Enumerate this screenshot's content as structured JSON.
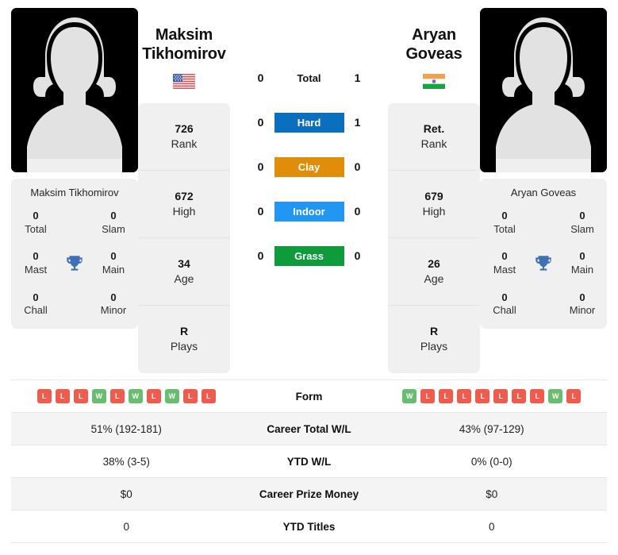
{
  "players": {
    "left": {
      "name_line1": "Maksim",
      "name_line2": "Tikhomirov",
      "full_name": "Maksim Tikhomirov",
      "flag_name": "usa-flag",
      "country": "USA",
      "avatar_name": "player-photo-placeholder",
      "stats": [
        {
          "value": "726",
          "label": "Rank"
        },
        {
          "value": "672",
          "label": "High"
        },
        {
          "value": "34",
          "label": "Age"
        },
        {
          "value": "R",
          "label": "Plays"
        }
      ],
      "titles": [
        {
          "value": "0",
          "label": "Total"
        },
        {
          "value": "0",
          "label": "Slam"
        },
        {
          "value": "0",
          "label": "Mast"
        },
        {
          "value": "0",
          "label": "Main"
        },
        {
          "value": "0",
          "label": "Chall"
        },
        {
          "value": "0",
          "label": "Minor"
        }
      ],
      "form": [
        "L",
        "L",
        "L",
        "W",
        "L",
        "W",
        "L",
        "W",
        "L",
        "L"
      ],
      "career_total_wl": "51% (192-181)",
      "ytd_wl": "38% (3-5)",
      "career_prize_money": "$0",
      "ytd_titles": "0"
    },
    "right": {
      "name_line1": "Aryan",
      "name_line2": "Goveas",
      "full_name": "Aryan Goveas",
      "flag_name": "india-flag",
      "country": "India",
      "avatar_name": "player-photo-placeholder",
      "stats": [
        {
          "value": "Ret.",
          "label": "Rank"
        },
        {
          "value": "679",
          "label": "High"
        },
        {
          "value": "26",
          "label": "Age"
        },
        {
          "value": "R",
          "label": "Plays"
        }
      ],
      "titles": [
        {
          "value": "0",
          "label": "Total"
        },
        {
          "value": "0",
          "label": "Slam"
        },
        {
          "value": "0",
          "label": "Mast"
        },
        {
          "value": "0",
          "label": "Main"
        },
        {
          "value": "0",
          "label": "Chall"
        },
        {
          "value": "0",
          "label": "Minor"
        }
      ],
      "form": [
        "W",
        "L",
        "L",
        "L",
        "L",
        "L",
        "L",
        "L",
        "W",
        "L"
      ],
      "career_total_wl": "43% (97-129)",
      "ytd_wl": "0% (0-0)",
      "career_prize_money": "$0",
      "ytd_titles": "0"
    }
  },
  "head_to_head": {
    "rows": [
      {
        "label": "Total",
        "left": "0",
        "right": "1",
        "color": null,
        "bar": false
      },
      {
        "label": "Hard",
        "left": "0",
        "right": "1",
        "color": "#0b6fc0",
        "bar": true
      },
      {
        "label": "Clay",
        "left": "0",
        "right": "0",
        "color": "#e08d0a",
        "bar": true
      },
      {
        "label": "Indoor",
        "left": "0",
        "right": "0",
        "color": "#2196f3",
        "bar": true
      },
      {
        "label": "Grass",
        "left": "0",
        "right": "0",
        "color": "#0d9b3c",
        "bar": true
      }
    ]
  },
  "table": {
    "rows": [
      {
        "key": "form",
        "label": "Form",
        "type": "form"
      },
      {
        "key": "career_total_wl",
        "label": "Career Total W/L",
        "type": "text"
      },
      {
        "key": "ytd_wl",
        "label": "YTD W/L",
        "type": "text"
      },
      {
        "key": "career_prize_money",
        "label": "Career Prize Money",
        "type": "text"
      },
      {
        "key": "ytd_titles",
        "label": "YTD Titles",
        "type": "text"
      }
    ]
  },
  "colors": {
    "win_badge": "#68bd6e",
    "loss_badge": "#ef5b4c",
    "hard": "#0b6fc0",
    "clay": "#e08d0a",
    "indoor": "#2196f3",
    "grass": "#0d9b3c",
    "trophy": "#3f6fb5",
    "card_bg": "#f0f0f0"
  }
}
